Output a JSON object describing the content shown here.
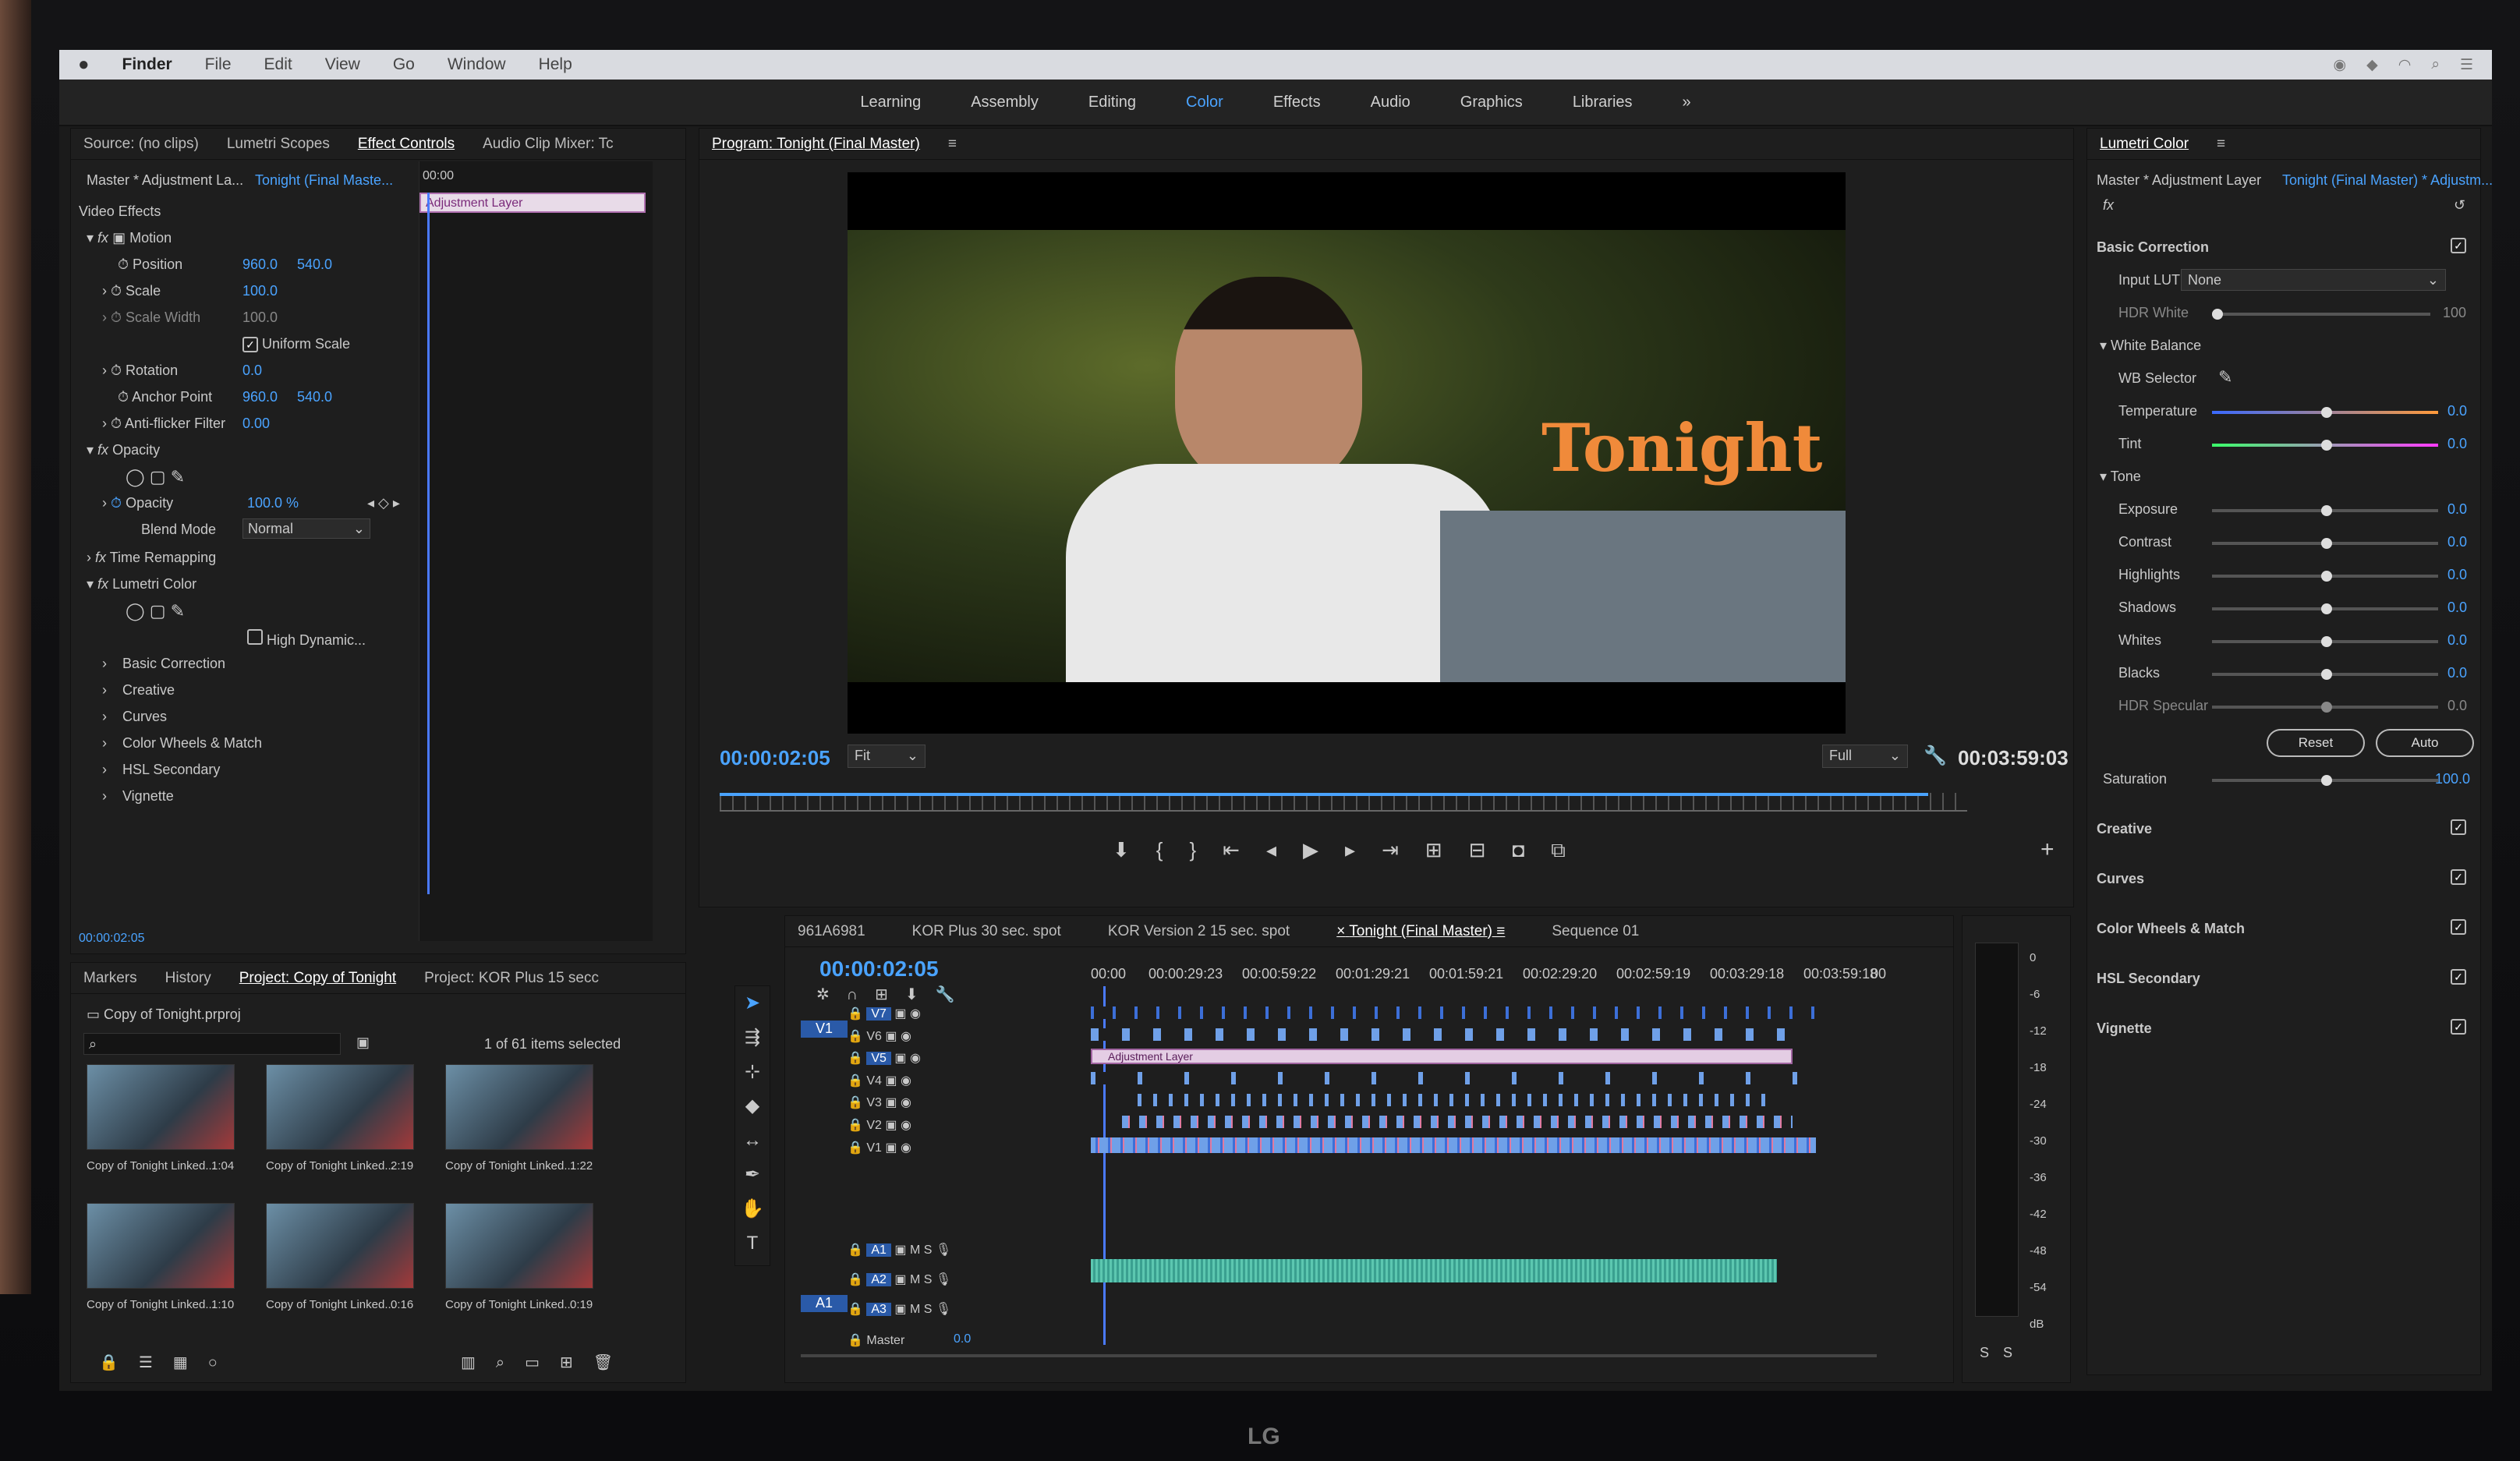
{
  "menubar": {
    "apple": "",
    "app": "Finder",
    "items": [
      "File",
      "Edit",
      "View",
      "Go",
      "Window",
      "Help"
    ]
  },
  "workspaces": [
    "Learning",
    "Assembly",
    "Editing",
    "Color",
    "Effects",
    "Audio",
    "Graphics",
    "Libraries"
  ],
  "workspaces_active": "Color",
  "workspaces_more": "»",
  "effect_controls": {
    "tabs": [
      "Source: (no clips)",
      "Lumetri Scopes",
      "Effect Controls",
      "Audio Clip Mixer: Tc"
    ],
    "active_tab": "Effect Controls",
    "master_label": "Master * Adjustment La...",
    "sequence_label": "Tonight (Final Maste...",
    "timecode_start": "00:00",
    "clip_label": "Adjustment Layer",
    "video_effects": "Video Effects",
    "motion": "Motion",
    "position": "Position",
    "position_x": "960.0",
    "position_y": "540.0",
    "scale": "Scale",
    "scale_val": "100.0",
    "scale_width": "Scale Width",
    "scale_width_val": "100.0",
    "uniform_scale": "Uniform Scale",
    "rotation": "Rotation",
    "rotation_val": "0.0",
    "anchor": "Anchor Point",
    "anchor_x": "960.0",
    "anchor_y": "540.0",
    "antiflicker": "Anti-flicker Filter",
    "antiflicker_val": "0.00",
    "opacity_group": "Opacity",
    "opacity": "Opacity",
    "opacity_val": "100.0 %",
    "blend_mode": "Blend Mode",
    "blend_val": "Normal",
    "time_remap": "Time Remapping",
    "lumetri": "Lumetri Color",
    "high_dynamic": "High Dynamic...",
    "sub": [
      "Basic Correction",
      "Creative",
      "Curves",
      "Color Wheels & Match",
      "HSL Secondary",
      "Vignette"
    ],
    "footer_tc": "00:00:02:05"
  },
  "program": {
    "title": "Program: Tonight (Final Master)",
    "overlay_text": "Tonight",
    "timecode": "00:00:02:05",
    "fit": "Fit",
    "quality": "Full",
    "duration": "00:03:59:03"
  },
  "lumetri": {
    "title": "Lumetri Color",
    "master": "Master * Adjustment Layer",
    "sequence": "Tonight (Final Master) * Adjustm...",
    "basic_correction": "Basic Correction",
    "input_lut": "Input LUT",
    "input_lut_val": "None",
    "hdr_white": "HDR White",
    "hdr_white_val": "100",
    "white_balance": "White Balance",
    "wb_selector": "WB Selector",
    "temperature": "Temperature",
    "tint": "Tint",
    "tone": "Tone",
    "tone_rows": [
      "Exposure",
      "Contrast",
      "Highlights",
      "Shadows",
      "Whites",
      "Blacks",
      "HDR Specular"
    ],
    "zero": "0.0",
    "reset": "Reset",
    "auto": "Auto",
    "saturation": "Saturation",
    "saturation_val": "100.0",
    "sections": [
      "Creative",
      "Curves",
      "Color Wheels & Match",
      "HSL Secondary",
      "Vignette"
    ]
  },
  "project": {
    "tabs": [
      "Markers",
      "History",
      "Project: Copy of Tonight",
      "Project: KOR Plus 15 secc"
    ],
    "active_tab": "Project: Copy of Tonight",
    "file": "Copy of Tonight.prproj",
    "selection": "1 of 61 items selected",
    "items": [
      {
        "name": "Copy of Tonight Linked...",
        "dur": "1:04"
      },
      {
        "name": "Copy of Tonight Linked...",
        "dur": "2:19"
      },
      {
        "name": "Copy of Tonight Linked...",
        "dur": "1:22"
      },
      {
        "name": "Copy of Tonight Linked...",
        "dur": "1:10"
      },
      {
        "name": "Copy of Tonight Linked...",
        "dur": "0:16"
      },
      {
        "name": "Copy of Tonight Linked...",
        "dur": "0:19"
      }
    ]
  },
  "timeline": {
    "tabs": [
      "961A6981",
      "KOR Plus 30 sec. spot",
      "KOR Version 2 15 sec. spot",
      "Tonight (Final Master)",
      "Sequence 01"
    ],
    "active_tab": "Tonight (Final Master)",
    "timecode": "00:00:02:05",
    "ruler": [
      "00:00",
      "00:00:29:23",
      "00:00:59:22",
      "00:01:29:21",
      "00:01:59:21",
      "00:02:29:20",
      "00:02:59:19",
      "00:03:29:18",
      "00:03:59:18",
      "00"
    ],
    "video_tracks": [
      "V7",
      "V6",
      "V5",
      "V4",
      "V3",
      "V2",
      "V1"
    ],
    "audio_tracks": [
      "A1",
      "A2",
      "A3"
    ],
    "adj_clip": "Adjustment Layer",
    "v1_source": "V1",
    "a1_source": "A1",
    "master": "Master",
    "master_val": "0.0",
    "m": "M",
    "s": "S"
  },
  "meter": {
    "labels": [
      "0",
      "-6",
      "-12",
      "-18",
      "-24",
      "-30",
      "-36",
      "-42",
      "-48",
      "-54",
      "dB"
    ],
    "s": "S"
  },
  "brand": "LG"
}
